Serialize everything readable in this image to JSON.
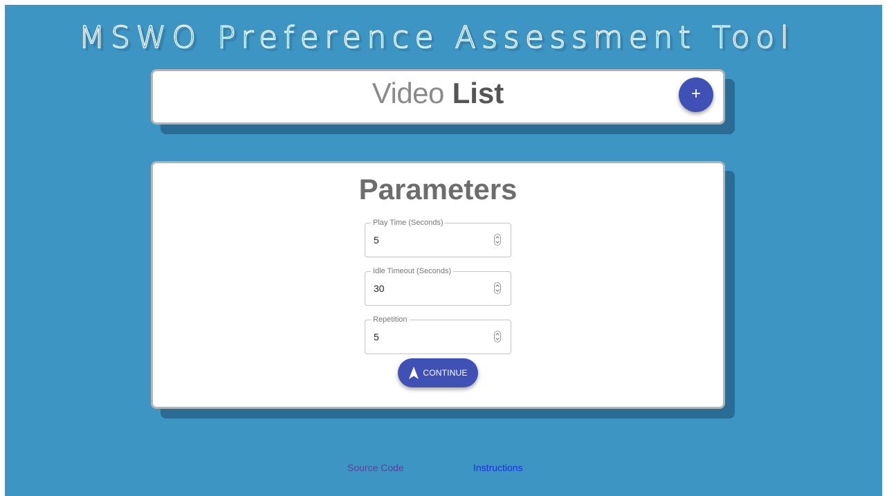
{
  "app": {
    "title": "MSWO Preference Assessment Tool"
  },
  "video_list": {
    "title_light": "Video",
    "title_bold": "List",
    "add_button_label": "+"
  },
  "parameters": {
    "title": "Parameters",
    "fields": [
      {
        "label": "Play Time (Seconds)",
        "value": "5"
      },
      {
        "label": "Idle Timeout (Seconds)",
        "value": "30"
      },
      {
        "label": "Repetition",
        "value": "5"
      }
    ],
    "continue_label": "CONTINUE"
  },
  "footer": {
    "source_code": "Source Code",
    "instructions": "Instructions"
  },
  "colors": {
    "background": "#3d95c4",
    "accent": "#3f51b5",
    "card": "#ffffff",
    "visited_link": "#5a3fa0",
    "link": "#1a2fe6"
  },
  "icons": {
    "add": "plus-icon",
    "continue": "navigation-arrow-icon",
    "spinner": "number-spinner-icon"
  }
}
